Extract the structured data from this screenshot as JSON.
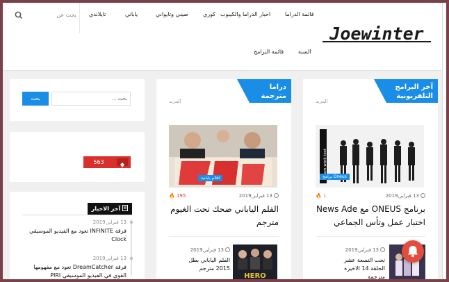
{
  "header": {
    "search_placeholder": "بحث عن",
    "nav_row1": [
      "قائمة الدراما",
      "اخبار الدراما والكيبوب",
      "كوري",
      "صيني وتايواني",
      "ياباني",
      "تايلاندي"
    ],
    "nav_row2": [
      "السنة",
      "قائمة البرامج"
    ],
    "logo_text": "Joewinter"
  },
  "col_right": {
    "heading_line1": "آخر البرامج",
    "heading_line2": "التلفزيونية",
    "more": "المزيد",
    "thumb_text": "Team work test",
    "badge": "برامج",
    "group": "Oneus",
    "date": "13 فبراير,2019",
    "views": "1",
    "title": "برنامج ONEUS مع News Ade اختبار عمل وتأس الجماعي",
    "sub_date": "13 فبراير,2019",
    "sub_title": "تحت التسعة عشر الحلقة 14 الاخيرة مترجمة"
  },
  "col_mid": {
    "heading_line1": "دراما",
    "heading_line2": "مترجمة",
    "more": "المزيد",
    "badge": "افلام يابانية",
    "date": "13 فبراير,2019",
    "views": "195",
    "title": "الفلم الياباني ضحك تحت الغيوم مترجم",
    "sub_date": "13 فبراير,2019",
    "sub_title": "الفلم الياباني بطل 2015 مترجم",
    "poster_text": "HERO"
  },
  "col_left": {
    "search_placeholder": "بحث ...",
    "search_button": "بحث",
    "counter": "563",
    "news_heading": "آخر الاخبار",
    "news": [
      {
        "date": "13 فبراير,2019",
        "title": "فرقة INFINITE تعود مع الفيديو الموسيقي Clock"
      },
      {
        "date": "13 فبراير,2019",
        "title": "فرقة DreamCatcher تعود مع مفهومها القوي في الفيديو الموسيقي PIRI"
      }
    ]
  },
  "colors": {
    "accent": "#1a8de6",
    "alert": "#d9302c",
    "frame": "#7a4148"
  }
}
